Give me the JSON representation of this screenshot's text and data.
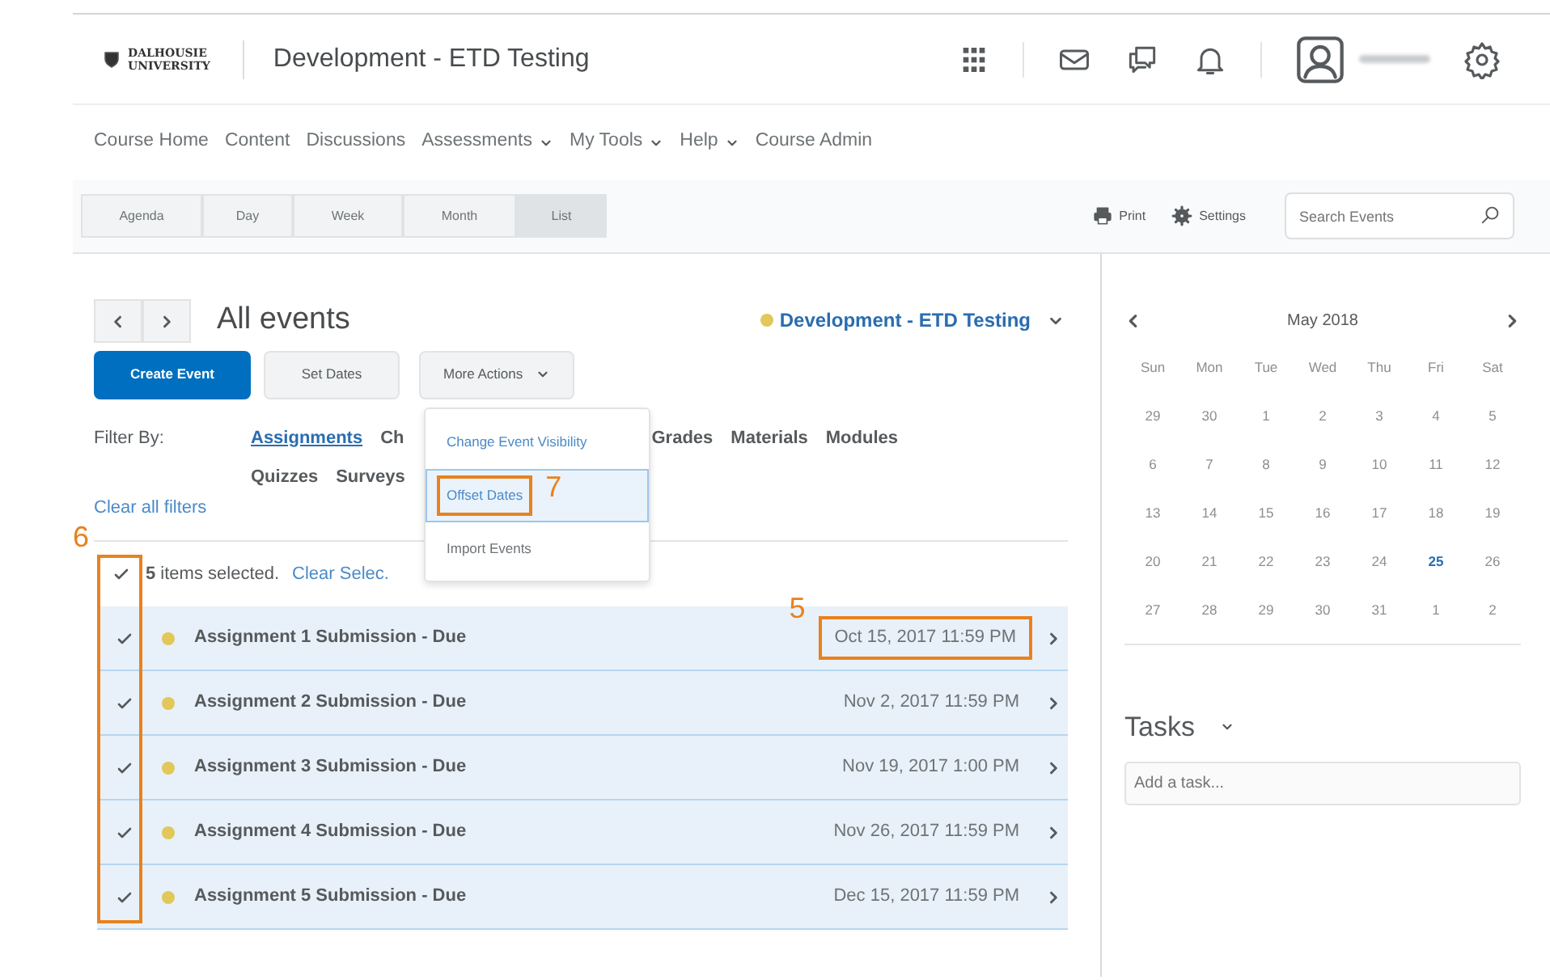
{
  "header": {
    "logo_lines": [
      "DALHOUSIE",
      "UNIVERSITY"
    ],
    "course_title": "Development - ETD Testing"
  },
  "nav": [
    {
      "label": "Course Home",
      "dropdown": false
    },
    {
      "label": "Content",
      "dropdown": false
    },
    {
      "label": "Discussions",
      "dropdown": false
    },
    {
      "label": "Assessments",
      "dropdown": true
    },
    {
      "label": "My Tools",
      "dropdown": true
    },
    {
      "label": "Help",
      "dropdown": true
    },
    {
      "label": "Course Admin",
      "dropdown": false
    }
  ],
  "view_tabs": [
    {
      "label": "Agenda",
      "selected": false
    },
    {
      "label": "Day",
      "selected": false
    },
    {
      "label": "Week",
      "selected": false
    },
    {
      "label": "Month",
      "selected": false
    },
    {
      "label": "List",
      "selected": true
    }
  ],
  "toolbar": {
    "print": "Print",
    "settings": "Settings",
    "search": {
      "placeholder": "Search Events"
    }
  },
  "events_header": {
    "title": "All events",
    "calendar": {
      "label": "Development - ETD Testing",
      "color": "#e2c75a"
    }
  },
  "buttons": [
    {
      "label": "Create Event",
      "kind": "primary"
    },
    {
      "label": "Set Dates",
      "kind": "secondary"
    },
    {
      "label": "More Actions",
      "kind": "dropdown"
    }
  ],
  "filter": {
    "label": "Filter By:",
    "lines": [
      [
        {
          "label": "Assignments",
          "selected": true
        },
        {
          "label": "Ch",
          "selected": false
        },
        {
          "label": "Grades",
          "selected": false
        },
        {
          "label": "Materials",
          "selected": false
        },
        {
          "label": "Modules",
          "selected": false
        }
      ],
      [
        {
          "label": "Quizzes",
          "selected": false
        },
        {
          "label": "Surveys",
          "selected": false
        }
      ]
    ],
    "clear": "Clear all filters"
  },
  "menu": {
    "items": [
      {
        "label": "Change Event Visibility",
        "selected": false
      },
      {
        "label": "Offset Dates",
        "selected": true,
        "callout": "7"
      },
      {
        "label": "Import Events",
        "selected": false
      }
    ]
  },
  "selection": {
    "checked": true,
    "text": "**5** items selected.",
    "clear": "Clear Selec.",
    "callout": "6"
  },
  "events": [
    {
      "title": "Assignment 1 Submission - Due",
      "date": "Oct 15, 2017 11:59 PM",
      "checked": true,
      "color": "#e2c75a",
      "callout": "5"
    },
    {
      "title": "Assignment 2 Submission - Due",
      "date": "Nov 2, 2017 11:59 PM",
      "checked": true,
      "color": "#e2c75a"
    },
    {
      "title": "Assignment 3 Submission - Due",
      "date": "Nov 19, 2017 1:00 PM",
      "checked": true,
      "color": "#e2c75a"
    },
    {
      "title": "Assignment 4 Submission - Due",
      "date": "Nov 26, 2017 11:59 PM",
      "checked": true,
      "color": "#e2c75a"
    },
    {
      "title": "Assignment 5 Submission - Due",
      "date": "Dec 15, 2017 11:59 PM",
      "checked": true,
      "color": "#e2c75a"
    }
  ],
  "mini_calendar": {
    "month": "May 2018",
    "weekdays": [
      "Sun",
      "Mon",
      "Tue",
      "Wed",
      "Thu",
      "Fri",
      "Sat"
    ],
    "weeks": [
      [
        {
          "d": "29",
          "today": false
        },
        {
          "d": "30",
          "today": false
        },
        {
          "d": "1",
          "today": false
        },
        {
          "d": "2",
          "today": false
        },
        {
          "d": "3",
          "today": false
        },
        {
          "d": "4",
          "today": false
        },
        {
          "d": "5",
          "today": false
        }
      ],
      [
        {
          "d": "6",
          "today": false
        },
        {
          "d": "7",
          "today": false
        },
        {
          "d": "8",
          "today": false
        },
        {
          "d": "9",
          "today": false
        },
        {
          "d": "10",
          "today": false
        },
        {
          "d": "11",
          "today": false
        },
        {
          "d": "12",
          "today": false
        }
      ],
      [
        {
          "d": "13",
          "today": false
        },
        {
          "d": "14",
          "today": false
        },
        {
          "d": "15",
          "today": false
        },
        {
          "d": "16",
          "today": false
        },
        {
          "d": "17",
          "today": false
        },
        {
          "d": "18",
          "today": false
        },
        {
          "d": "19",
          "today": false
        }
      ],
      [
        {
          "d": "20",
          "today": false
        },
        {
          "d": "21",
          "today": false
        },
        {
          "d": "22",
          "today": false
        },
        {
          "d": "23",
          "today": false
        },
        {
          "d": "24",
          "today": false
        },
        {
          "d": "25",
          "today": true
        },
        {
          "d": "26",
          "today": false
        }
      ],
      [
        {
          "d": "27",
          "today": false
        },
        {
          "d": "28",
          "today": false
        },
        {
          "d": "29",
          "today": false
        },
        {
          "d": "30",
          "today": false
        },
        {
          "d": "31",
          "today": false
        },
        {
          "d": "1",
          "today": false
        },
        {
          "d": "2",
          "today": false
        }
      ]
    ]
  },
  "tasks": {
    "title": "Tasks",
    "placeholder": "Add a task..."
  }
}
